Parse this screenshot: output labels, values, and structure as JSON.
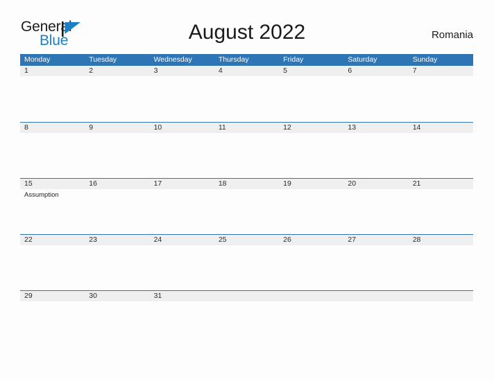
{
  "brand": {
    "line1": "General",
    "line2": "Blue",
    "flag_icon": "flag-triangle-icon",
    "line1_color": "#1c1c1c",
    "line2_color": "#1b7fc4",
    "flag_color": "#1b7fc4"
  },
  "header": {
    "title": "August 2022",
    "country": "Romania"
  },
  "theme": {
    "header_blue": "#2e75b6",
    "date_band_gray": "#efefef",
    "page_background": "#fdfdfd",
    "text_color": "#222222",
    "header_text_color": "#ffffff"
  },
  "calendar": {
    "weekdays": [
      "Monday",
      "Tuesday",
      "Wednesday",
      "Thursday",
      "Friday",
      "Saturday",
      "Sunday"
    ],
    "weeks": [
      {
        "days": [
          {
            "date": "1",
            "events": []
          },
          {
            "date": "2",
            "events": []
          },
          {
            "date": "3",
            "events": []
          },
          {
            "date": "4",
            "events": []
          },
          {
            "date": "5",
            "events": []
          },
          {
            "date": "6",
            "events": []
          },
          {
            "date": "7",
            "events": []
          }
        ]
      },
      {
        "days": [
          {
            "date": "8",
            "events": []
          },
          {
            "date": "9",
            "events": []
          },
          {
            "date": "10",
            "events": []
          },
          {
            "date": "11",
            "events": []
          },
          {
            "date": "12",
            "events": []
          },
          {
            "date": "13",
            "events": []
          },
          {
            "date": "14",
            "events": []
          }
        ]
      },
      {
        "days": [
          {
            "date": "15",
            "events": [
              "Assumption"
            ]
          },
          {
            "date": "16",
            "events": []
          },
          {
            "date": "17",
            "events": []
          },
          {
            "date": "18",
            "events": []
          },
          {
            "date": "19",
            "events": []
          },
          {
            "date": "20",
            "events": []
          },
          {
            "date": "21",
            "events": []
          }
        ]
      },
      {
        "days": [
          {
            "date": "22",
            "events": []
          },
          {
            "date": "23",
            "events": []
          },
          {
            "date": "24",
            "events": []
          },
          {
            "date": "25",
            "events": []
          },
          {
            "date": "26",
            "events": []
          },
          {
            "date": "27",
            "events": []
          },
          {
            "date": "28",
            "events": []
          }
        ]
      },
      {
        "days": [
          {
            "date": "29",
            "events": []
          },
          {
            "date": "30",
            "events": []
          },
          {
            "date": "31",
            "events": []
          },
          {
            "date": "",
            "events": []
          },
          {
            "date": "",
            "events": []
          },
          {
            "date": "",
            "events": []
          },
          {
            "date": "",
            "events": []
          }
        ]
      }
    ]
  }
}
